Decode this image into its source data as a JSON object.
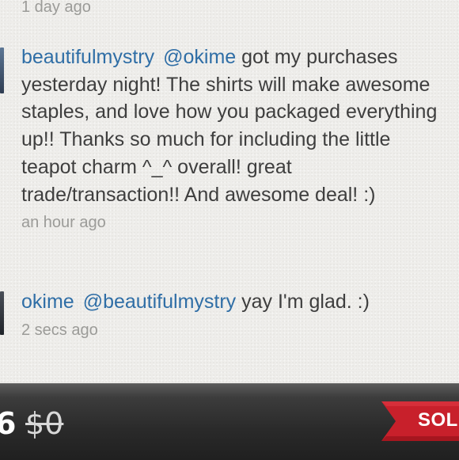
{
  "comments": [
    {
      "username": "beautifulmystry",
      "mention": "@okime",
      "text": "got my purchases yesterday night! The shirts will make awesome staples, and love how you packaged everything up!! Thanks so much for including the little teapot charm ^_^ overall! great trade/transaction!! And awesome deal! :)",
      "time": "an hour ago"
    },
    {
      "username": "okime",
      "mention": "@beautifulmystry",
      "text": "yay I'm glad. :)",
      "time": "2 secs ago"
    }
  ],
  "previous_comment_time": "1 day ago",
  "listing": {
    "price": "6",
    "original_price": "$0",
    "status_label": "SOLD"
  },
  "colors": {
    "link": "#2f6ea6",
    "sold_ribbon": "#c8202b"
  }
}
